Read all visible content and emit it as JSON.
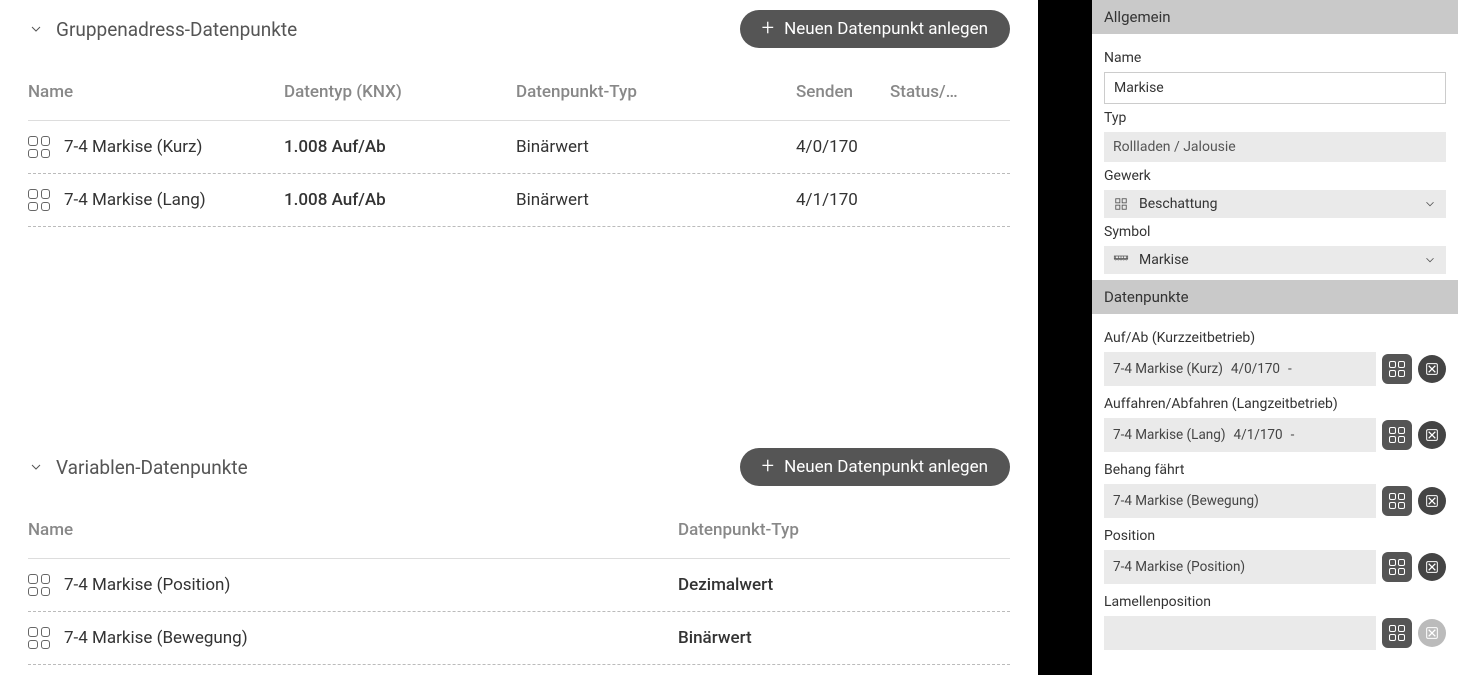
{
  "sections": {
    "group": {
      "title": "Gruppenadress-Datenpunkte",
      "new_btn": "Neuen Datenpunkt anlegen",
      "headers": {
        "name": "Name",
        "datatype": "Datentyp (KNX)",
        "dptype": "Datenpunkt-Typ",
        "send": "Senden",
        "status": "Status/…"
      },
      "rows": [
        {
          "name": "7-4 Markise (Kurz)",
          "datatype": "1.008 Auf/Ab",
          "dptype": "Binärwert",
          "send": "4/0/170"
        },
        {
          "name": "7-4 Markise (Lang)",
          "datatype": "1.008 Auf/Ab",
          "dptype": "Binärwert",
          "send": "4/1/170"
        }
      ]
    },
    "var": {
      "title": "Variablen-Datenpunkte",
      "new_btn": "Neuen Datenpunkt anlegen",
      "headers": {
        "name": "Name",
        "dptype": "Datenpunkt-Typ"
      },
      "rows": [
        {
          "name": "7-4 Markise (Position)",
          "dptype": "Dezimalwert"
        },
        {
          "name": "7-4 Markise (Bewegung)",
          "dptype": "Binärwert"
        }
      ]
    }
  },
  "side": {
    "general": {
      "heading": "Allgemein",
      "name_label": "Name",
      "name_value": "Markise",
      "type_label": "Typ",
      "type_value": "Rollladen / Jalousie",
      "gewerk_label": "Gewerk",
      "gewerk_value": "Beschattung",
      "symbol_label": "Symbol",
      "symbol_value": "Markise"
    },
    "dp": {
      "heading": "Datenpunkte",
      "items": [
        {
          "label": "Auf/Ab (Kurzzeitbetrieb)",
          "name": "7-4 Markise (Kurz)",
          "addr": "4/0/170",
          "extra": "-"
        },
        {
          "label": "Auffahren/Abfahren (Langzeitbetrieb)",
          "name": "7-4 Markise (Lang)",
          "addr": "4/1/170",
          "extra": "-"
        },
        {
          "label": "Behang fährt",
          "name": "7-4 Markise (Bewegung)",
          "addr": "",
          "extra": ""
        },
        {
          "label": "Position",
          "name": "7-4 Markise (Position)",
          "addr": "",
          "extra": ""
        },
        {
          "label": "Lamellenposition",
          "name": "",
          "addr": "",
          "extra": ""
        }
      ]
    }
  }
}
